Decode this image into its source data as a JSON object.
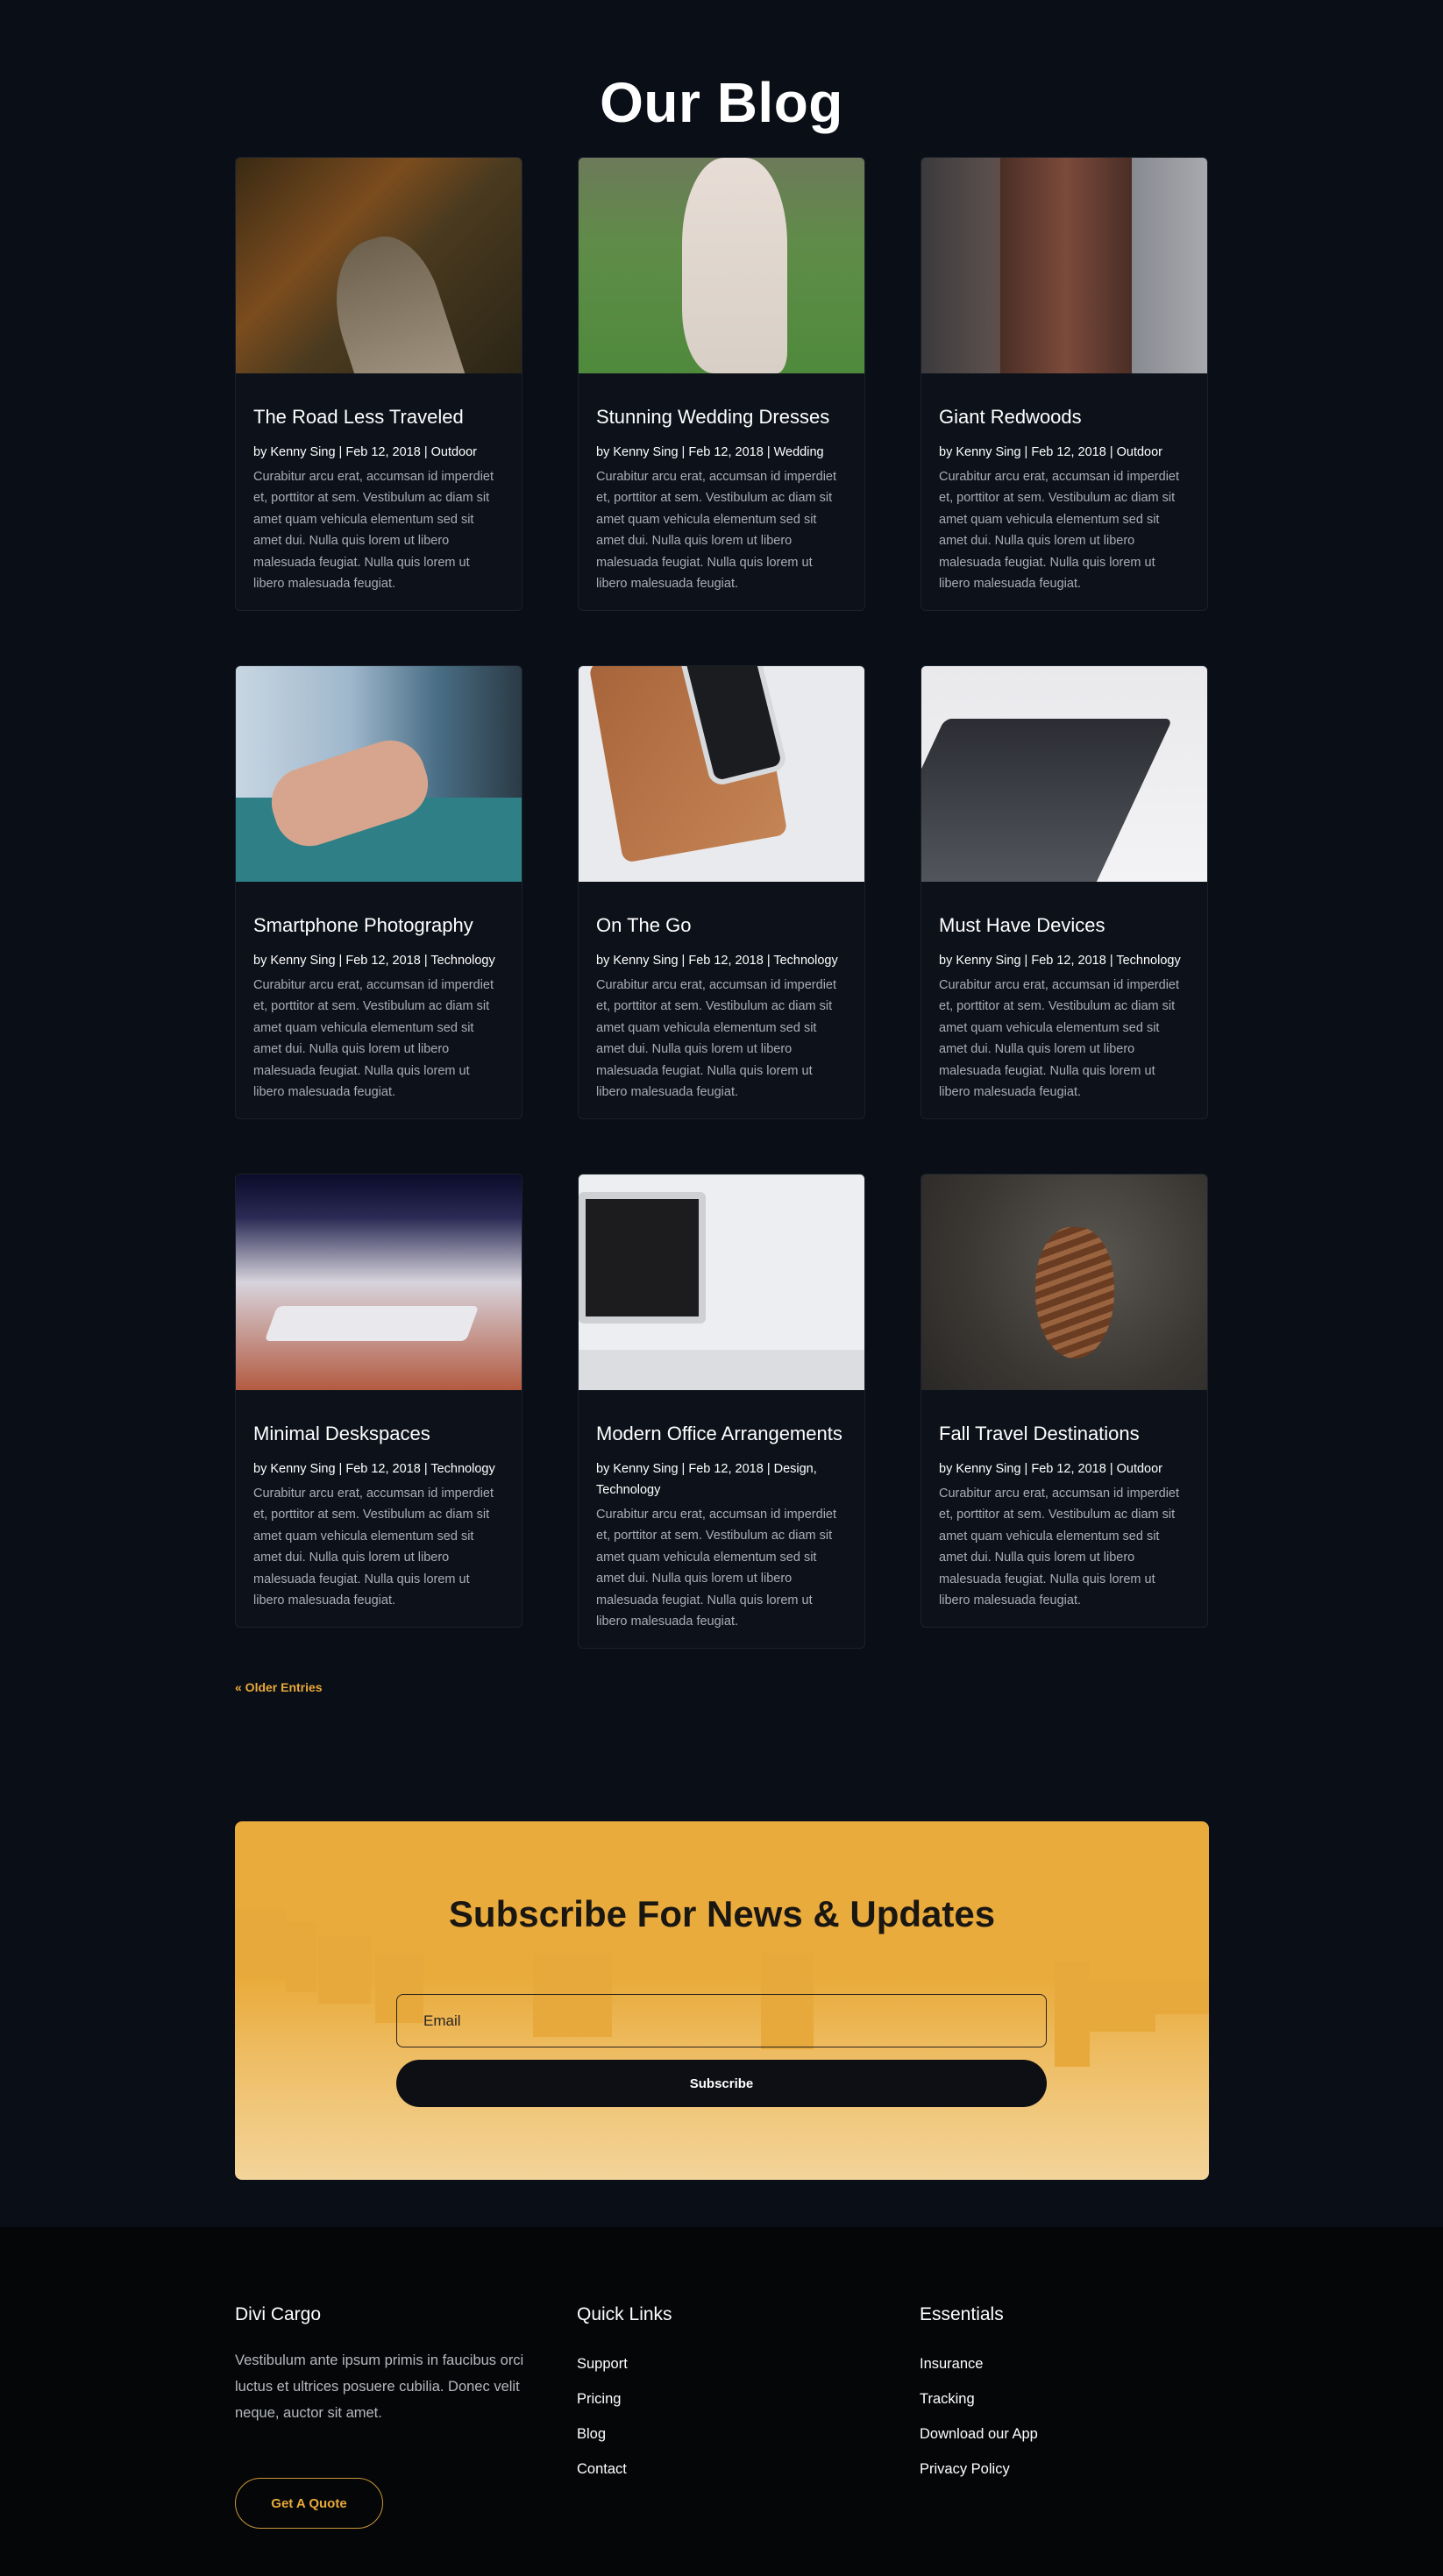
{
  "blog": {
    "title": "Our Blog",
    "posts": [
      {
        "title": "The Road Less Traveled",
        "meta": "by Kenny Sing | Feb 12, 2018 | Outdoor",
        "excerpt": "Curabitur arcu erat, accumsan id imperdiet et, porttitor at sem. Vestibulum ac diam sit amet quam vehicula elementum sed sit amet dui. Nulla quis lorem ut libero malesuada feugiat. Nulla quis lorem ut libero malesuada feugiat.",
        "image": "forest-road-photo"
      },
      {
        "title": "Stunning Wedding Dresses",
        "meta": "by Kenny Sing | Feb 12, 2018 | Wedding",
        "excerpt": "Curabitur arcu erat, accumsan id imperdiet et, porttitor at sem. Vestibulum ac diam sit amet quam vehicula elementum sed sit amet dui. Nulla quis lorem ut libero malesuada feugiat. Nulla quis lorem ut libero malesuada feugiat.",
        "image": "wedding-dress-photo"
      },
      {
        "title": "Giant Redwoods",
        "meta": "by Kenny Sing | Feb 12, 2018 | Outdoor",
        "excerpt": "Curabitur arcu erat, accumsan id imperdiet et, porttitor at sem. Vestibulum ac diam sit amet quam vehicula elementum sed sit amet dui. Nulla quis lorem ut libero malesuada feugiat. Nulla quis lorem ut libero malesuada feugiat.",
        "image": "redwood-tree-photo"
      },
      {
        "title": "Smartphone Photography",
        "meta": "by Kenny Sing | Feb 12, 2018 | Technology",
        "excerpt": "Curabitur arcu erat, accumsan id imperdiet et, porttitor at sem. Vestibulum ac diam sit amet quam vehicula elementum sed sit amet dui. Nulla quis lorem ut libero malesuada feugiat. Nulla quis lorem ut libero malesuada feugiat.",
        "image": "smartphone-photo"
      },
      {
        "title": "On The Go",
        "meta": "by Kenny Sing | Feb 12, 2018 | Technology",
        "excerpt": "Curabitur arcu erat, accumsan id imperdiet et, porttitor at sem. Vestibulum ac diam sit amet quam vehicula elementum sed sit amet dui. Nulla quis lorem ut libero malesuada feugiat. Nulla quis lorem ut libero malesuada feugiat.",
        "image": "tablet-phone-photo"
      },
      {
        "title": "Must Have Devices",
        "meta": "by Kenny Sing | Feb 12, 2018 | Technology",
        "excerpt": "Curabitur arcu erat, accumsan id imperdiet et, porttitor at sem. Vestibulum ac diam sit amet quam vehicula elementum sed sit amet dui. Nulla quis lorem ut libero malesuada feugiat. Nulla quis lorem ut libero malesuada feugiat.",
        "image": "laptop-photo"
      },
      {
        "title": "Minimal Deskspaces",
        "meta": "by Kenny Sing | Feb 12, 2018 | Technology",
        "excerpt": "Curabitur arcu erat, accumsan id imperdiet et, porttitor at sem. Vestibulum ac diam sit amet quam vehicula elementum sed sit amet dui. Nulla quis lorem ut libero malesuada feugiat. Nulla quis lorem ut libero malesuada feugiat.",
        "image": "keyboard-photo"
      },
      {
        "title": "Modern Office Arrangements",
        "meta": "by Kenny Sing | Feb 12, 2018 | Design, Technology",
        "excerpt": "Curabitur arcu erat, accumsan id imperdiet et, porttitor at sem. Vestibulum ac diam sit amet quam vehicula elementum sed sit amet dui. Nulla quis lorem ut libero malesuada feugiat. Nulla quis lorem ut libero malesuada feugiat.",
        "image": "office-desk-photo"
      },
      {
        "title": "Fall Travel Destinations",
        "meta": "by Kenny Sing | Feb 12, 2018 | Outdoor",
        "excerpt": "Curabitur arcu erat, accumsan id imperdiet et, porttitor at sem. Vestibulum ac diam sit amet quam vehicula elementum sed sit amet dui. Nulla quis lorem ut libero malesuada feugiat. Nulla quis lorem ut libero malesuada feugiat.",
        "image": "pine-cone-photo"
      }
    ],
    "older_entries": "« Older Entries"
  },
  "subscribe": {
    "title": "Subscribe For News & Updates",
    "email_placeholder": "Email",
    "button_label": "Subscribe"
  },
  "footer": {
    "about": {
      "heading": "Divi Cargo",
      "text": "Vestibulum ante ipsum primis in faucibus orci luctus et ultrices posuere cubilia. Donec velit neque, auctor sit amet.",
      "button_label": "Get A Quote"
    },
    "quick_links": {
      "heading": "Quick Links",
      "items": [
        "Support",
        "Pricing",
        "Blog",
        "Contact"
      ]
    },
    "essentials": {
      "heading": "Essentials",
      "items": [
        "Insurance",
        "Tracking",
        "Download our App",
        "Privacy Policy"
      ]
    }
  },
  "colors": {
    "background": "#0a0e16",
    "accent": "#e8a93a",
    "footer_background": "#050608"
  }
}
